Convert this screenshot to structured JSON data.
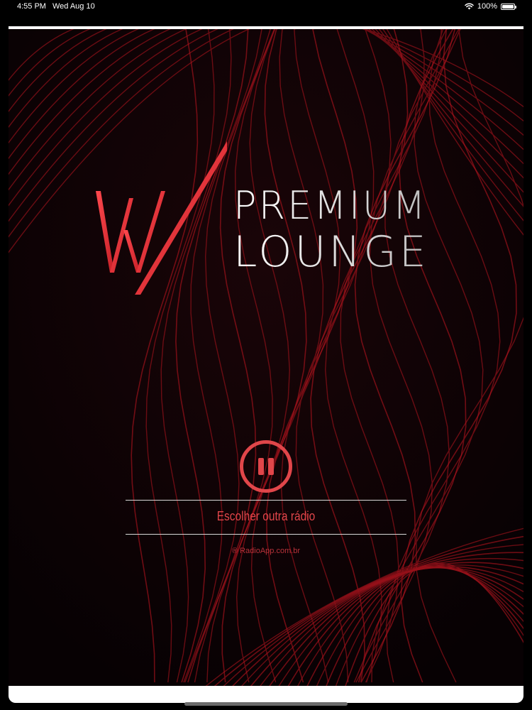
{
  "status_bar": {
    "time": "4:55 PM",
    "date": "Wed Aug 10",
    "battery_percent": "100%",
    "battery_level": 1.0
  },
  "logo": {
    "line1": "PREMIUM",
    "line2": "LOUNGE"
  },
  "player": {
    "state": "playing",
    "pause_icon": "pause-icon"
  },
  "actions": {
    "choose_other_radio": "Escolher outra rádio"
  },
  "footer": {
    "credit": "® RadioApp.com.br"
  },
  "colors": {
    "accent": "#e0464a",
    "background": "#0b0206",
    "logo_text": "#e6e6e6"
  }
}
